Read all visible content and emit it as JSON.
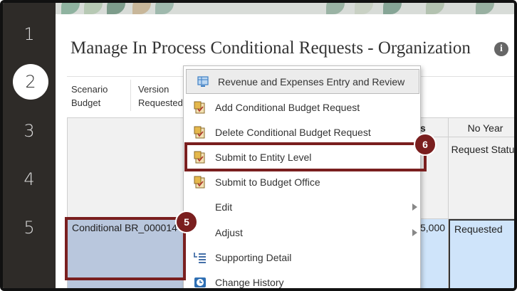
{
  "steps": [
    "1",
    "2",
    "3",
    "4",
    "5"
  ],
  "page": {
    "title": "Manage In Process Conditional Requests - Organization"
  },
  "pov": [
    {
      "label": "Scenario",
      "value": "Budget"
    },
    {
      "label": "Version",
      "value": "Requested"
    }
  ],
  "grid": {
    "partial_header": "s",
    "column_header": "No Year",
    "column_subheader": "Request Status",
    "row_label": "Conditional BR_000014",
    "partial_value": "5,000",
    "status_value": "Requested"
  },
  "menu": {
    "items": [
      {
        "label": "Revenue and Expenses Entry and Review",
        "icon": "form-grid-icon",
        "submenu": false
      },
      {
        "label": "Add Conditional Budget Request",
        "icon": "business-rule-icon",
        "submenu": false
      },
      {
        "label": "Delete Conditional Budget Request",
        "icon": "business-rule-icon",
        "submenu": false
      },
      {
        "label": "Submit to Entity Level",
        "icon": "business-rule-icon",
        "submenu": false
      },
      {
        "label": "Submit to Budget Office",
        "icon": "business-rule-icon",
        "submenu": false
      },
      {
        "label": "Edit",
        "icon": "",
        "submenu": true
      },
      {
        "label": "Adjust",
        "icon": "",
        "submenu": true
      },
      {
        "label": "Supporting Detail",
        "icon": "supporting-detail-icon",
        "submenu": false
      },
      {
        "label": "Change History",
        "icon": "change-history-icon",
        "submenu": false
      }
    ]
  },
  "callouts": [
    "5",
    "6"
  ],
  "colors": {
    "accent": "#7a1f1f",
    "rail": "#2e2b28",
    "selection": "#b9c7dd",
    "data_cell": "#cfe4fa"
  }
}
